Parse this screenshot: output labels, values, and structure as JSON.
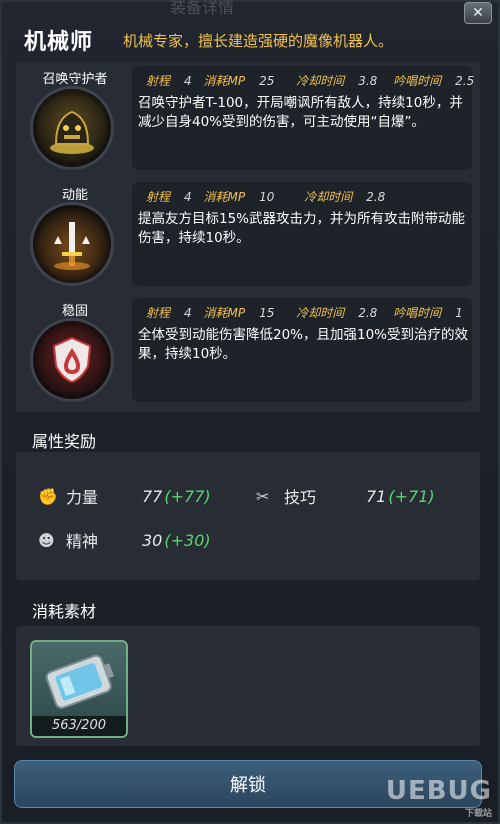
{
  "header": {
    "top_partial": "装备详情",
    "class_name": "机械师",
    "class_desc": "机械专家，擅长建造强硬的魔像机器人。",
    "close": "✕"
  },
  "skills": [
    {
      "name": "召唤守护者",
      "icon": "summon-guardian-icon",
      "range_label": "射程",
      "range": "4",
      "mp_label": "消耗MP",
      "mp": "25",
      "cd_label": "冷却时间",
      "cd": "3.8",
      "cast_label": "吟唱时间",
      "cast": "2.5",
      "text": "召唤守护者T-100，开局嘲讽所有敌人，持续10秒，并减少自身40%受到的伤害，可主动使用“自爆”。"
    },
    {
      "name": "动能",
      "icon": "kinetic-sword-icon",
      "range_label": "射程",
      "range": "4",
      "mp_label": "消耗MP",
      "mp": "10",
      "cd_label": "冷却时间",
      "cd": "2.8",
      "text": "提高友方目标15%武器攻击力，并为所有攻击附带动能伤害，持续10秒。"
    },
    {
      "name": "稳固",
      "icon": "shield-drop-icon",
      "range_label": "射程",
      "range": "4",
      "mp_label": "消耗MP",
      "mp": "15",
      "cd_label": "冷却时间",
      "cd": "2.8",
      "cast_label": "吟唱时间",
      "cast": "1",
      "text": "全体受到动能伤害降低20%，且加强10%受到治疗的效果，持续10秒。"
    }
  ],
  "attributes": {
    "title": "属性奖励",
    "items": [
      {
        "label": "力量",
        "value": "77",
        "bonus": "(+77)",
        "icon": "fist-icon"
      },
      {
        "label": "技巧",
        "value": "71",
        "bonus": "(+71)",
        "icon": "tools-icon"
      },
      {
        "label": "精神",
        "value": "30",
        "bonus": "(+30)",
        "icon": "brain-head-icon"
      }
    ]
  },
  "materials": {
    "title": "消耗素材",
    "item_icon": "battery-cell-icon",
    "count": "563/200"
  },
  "action": {
    "unlock_label": "解锁"
  },
  "watermark": {
    "text": "UEBUG",
    "sub": "下载站"
  }
}
